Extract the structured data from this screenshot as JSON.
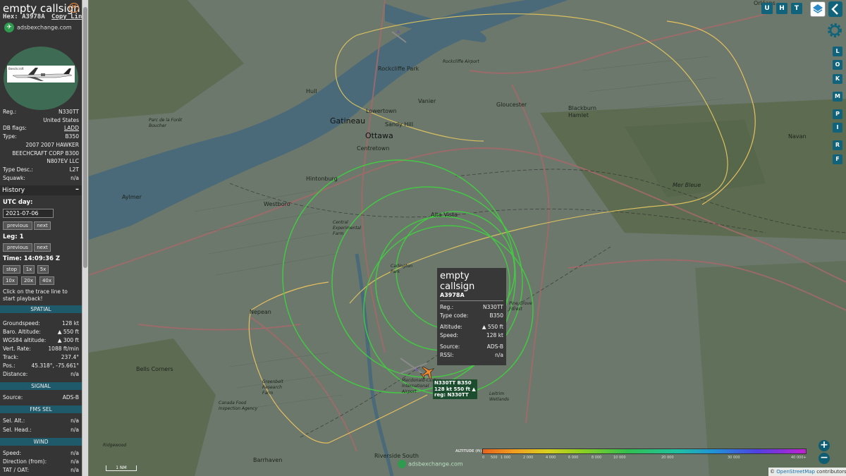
{
  "aircraft": {
    "callsign": "empty callsign",
    "hex_label": "Hex:",
    "hex": "A3978A",
    "copy_link": "Copy Link",
    "site": "adsbexchange.com"
  },
  "details": [
    {
      "k": "Reg.:",
      "v": "N330TT"
    },
    {
      "k": "",
      "v": "United States"
    },
    {
      "k": "DB flags:",
      "v": "LADD"
    },
    {
      "k": "Type:",
      "v": "B350"
    },
    {
      "k": "",
      "v": "2007 2007 HAWKER"
    },
    {
      "k": "",
      "v": "BEECHCRAFT CORP B300"
    },
    {
      "k": "",
      "v": "N807EV LLC"
    },
    {
      "k": "Type Desc.:",
      "v": "L2T"
    },
    {
      "k": "Squawk:",
      "v": "n/a"
    }
  ],
  "history": {
    "title": "History",
    "collapse": "–",
    "utc_day_label": "UTC day:",
    "utc_day": "2021-07-06",
    "previous": "previous",
    "next": "next",
    "leg_label": "Leg: 1",
    "time_label": "Time: 14:09:36 Z",
    "speed_buttons": [
      "stop",
      "1x",
      "5x",
      "10x",
      "20x",
      "40x"
    ],
    "hint": "Click on the trace line to start playback!"
  },
  "sections": {
    "spatial": "SPATIAL",
    "signal": "SIGNAL",
    "fms": "FMS SEL",
    "wind": "WIND"
  },
  "spatial": [
    {
      "k": "Groundspeed:",
      "v": "128 kt"
    },
    {
      "k": "Baro. Altitude:",
      "v": "▲ 550 ft"
    },
    {
      "k": "WGS84 altitude:",
      "v": "▲ 300 ft"
    },
    {
      "k": "Vert. Rate:",
      "v": "1088 ft/min"
    },
    {
      "k": "Track:",
      "v": "237.4°"
    },
    {
      "k": "Pos.:",
      "v": "45.318°, -75.661°"
    },
    {
      "k": "Distance:",
      "v": "n/a"
    }
  ],
  "signal": [
    {
      "k": "Source:",
      "v": "ADS-B"
    }
  ],
  "fms": [
    {
      "k": "Sel. Alt.:",
      "v": "n/a"
    },
    {
      "k": "Sel. Head.:",
      "v": "n/a"
    }
  ],
  "wind": [
    {
      "k": "Speed:",
      "v": "n/a"
    },
    {
      "k": "Direction (from):",
      "v": "n/a"
    },
    {
      "k": "TAT / OAT:",
      "v": "n/a"
    }
  ],
  "popup": {
    "title": "empty callsign",
    "hex": "A3978A",
    "rows": [
      {
        "k": "Reg.:",
        "v": "N330TT"
      },
      {
        "k": "Type code:",
        "v": "B350"
      },
      {
        "k": "Altitude:",
        "v": "▲ 550 ft"
      },
      {
        "k": "Speed:",
        "v": "128 kt"
      },
      {
        "k": "Source:",
        "v": "ADS-B"
      },
      {
        "k": "RSSI:",
        "v": "n/a"
      }
    ]
  },
  "plane_label": [
    "N330TT B350",
    "128 kt  550 ft ▲",
    "reg: N330TT"
  ],
  "toolbar_top": [
    "U",
    "H",
    "T"
  ],
  "toolbar_right": [
    "L",
    "O",
    "K",
    "M",
    "P",
    "I",
    "R",
    "F"
  ],
  "places": [
    "Gatineau",
    "Ottawa",
    "Rockcliffe Park",
    "Vanier",
    "Gloucester",
    "Blackburn Hamlet",
    "Lowertown",
    "Sandy Hill",
    "Centretown",
    "Hintonburg",
    "Westboro",
    "Alta Vista",
    "Aylmer",
    "Nepean",
    "Bells Corners",
    "Barrhaven",
    "Riverside South",
    "Navan",
    "Mer Bleue",
    "Hull",
    "Orléans",
    "Parc de la Forêt Boucher",
    "Central Experimental Farm",
    "Macdonald-Cartier International Airport",
    "Greenbelt Research Farm",
    "Canada Food Inspection Agency",
    "Leitrim Wetlands",
    "Rockcliffe Airport",
    "Ridgewood",
    "Carlington Park",
    "Pine Grove Forest"
  ],
  "altitude_legend": {
    "title": "ALTITUDE (ft)",
    "ticks": [
      "0",
      "500",
      "1 000",
      "2 000",
      "4 000",
      "6 000",
      "8 000",
      "10 000",
      "20 000",
      "30 000",
      "40 000+"
    ]
  },
  "scale": "1 NM",
  "watermark": "adsbexchange.com",
  "attribution": {
    "prefix": "© ",
    "link": "OpenStreetMap",
    "suffix": " contributors."
  },
  "icons": [
    "close-icon",
    "adsbx-logo-icon",
    "layers-icon",
    "collapse-left-icon",
    "settings-gear-icon",
    "zoom-in-icon",
    "zoom-out-icon",
    "aircraft-icon"
  ]
}
